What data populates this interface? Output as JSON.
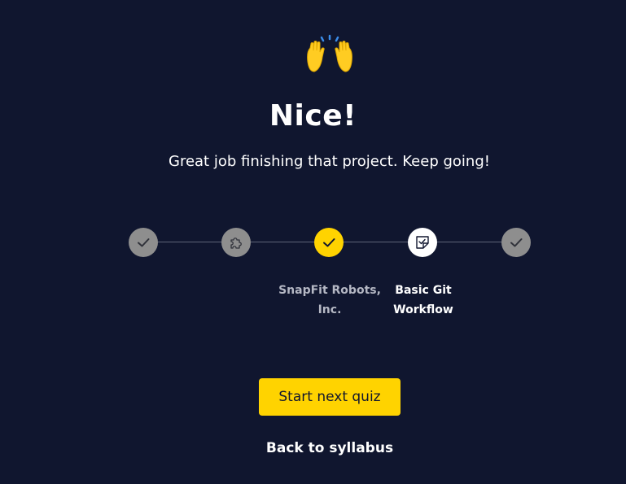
{
  "header": {
    "icon": "raising-hands-icon",
    "title": "Nice!",
    "subtitle": "Great job finishing that project. Keep going!"
  },
  "progress": {
    "steps": [
      {
        "icon": "check-icon",
        "state": "completed",
        "label": ""
      },
      {
        "icon": "puzzle-icon",
        "state": "completed",
        "label": ""
      },
      {
        "icon": "check-icon",
        "state": "just-completed",
        "label": "SnapFit Robots, Inc."
      },
      {
        "icon": "quiz-icon",
        "state": "next",
        "label": "Basic Git Workflow"
      },
      {
        "icon": "check-icon",
        "state": "completed",
        "label": ""
      }
    ]
  },
  "actions": {
    "primary_label": "Start next quiz",
    "secondary_label": "Back to syllabus"
  },
  "colors": {
    "background": "#10162f",
    "accent": "#ffd300",
    "completed": "#8e8e8e"
  }
}
